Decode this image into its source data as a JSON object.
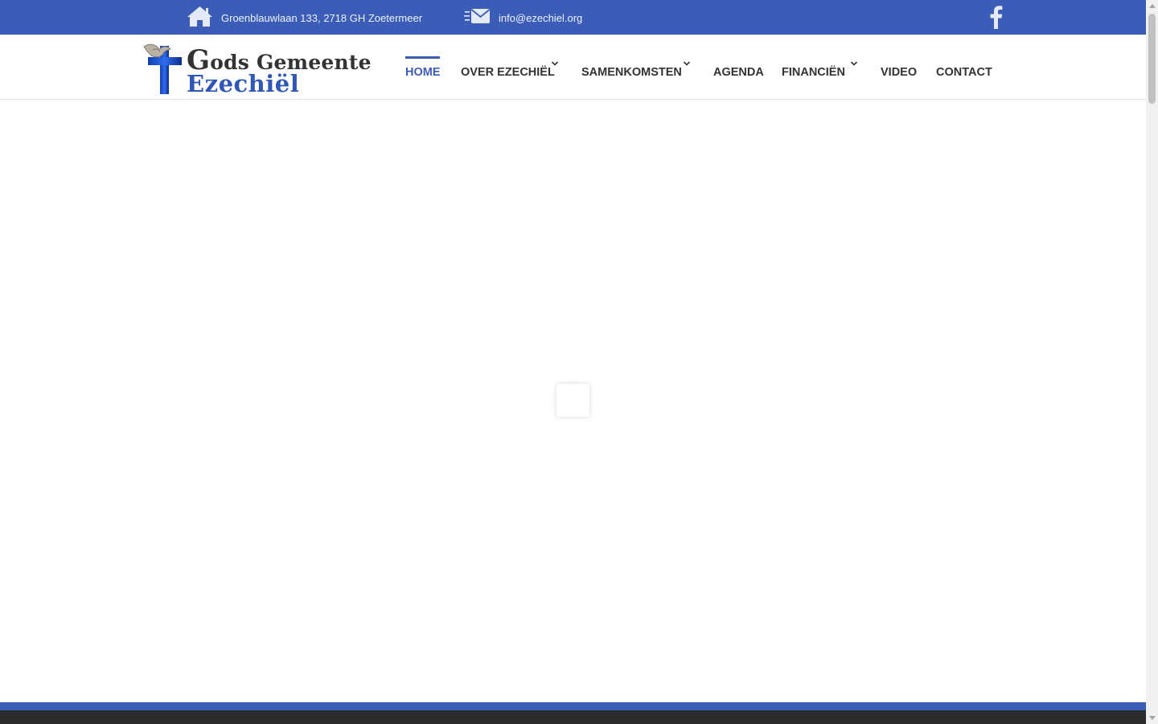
{
  "topbar": {
    "address": "Groenblauwlaan 133, 2718 GH Zoetermeer",
    "email": "info@ezechiel.org",
    "icons": {
      "address": "home-icon",
      "email": "mail-icon",
      "social": "facebook-icon"
    }
  },
  "logo": {
    "line1_first": "G",
    "line1_rest": "ods Gemeente",
    "line2": "Ezechiël"
  },
  "nav": {
    "items": [
      {
        "label": "HOME",
        "active": true,
        "dropdown": false
      },
      {
        "label": "OVER EZECHIËL",
        "active": false,
        "dropdown": true
      },
      {
        "label": "SAMENKOMSTEN",
        "active": false,
        "dropdown": true
      },
      {
        "label": "AGENDA",
        "active": false,
        "dropdown": false
      },
      {
        "label": "FINANCIËN",
        "active": false,
        "dropdown": true
      },
      {
        "label": "VIDEO",
        "active": false,
        "dropdown": false
      },
      {
        "label": "CONTACT",
        "active": false,
        "dropdown": false
      }
    ]
  },
  "colors": {
    "accent": "#3b5db8",
    "text": "#333333",
    "footer": "#2b2b2b"
  }
}
